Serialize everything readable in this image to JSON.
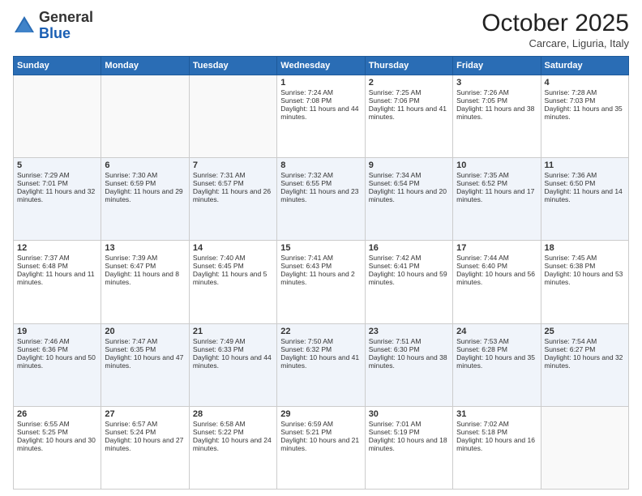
{
  "header": {
    "logo_general": "General",
    "logo_blue": "Blue",
    "month_title": "October 2025",
    "location": "Carcare, Liguria, Italy"
  },
  "days_of_week": [
    "Sunday",
    "Monday",
    "Tuesday",
    "Wednesday",
    "Thursday",
    "Friday",
    "Saturday"
  ],
  "weeks": [
    [
      {
        "day": "",
        "info": ""
      },
      {
        "day": "",
        "info": ""
      },
      {
        "day": "",
        "info": ""
      },
      {
        "day": "1",
        "info": "Sunrise: 7:24 AM\nSunset: 7:08 PM\nDaylight: 11 hours and 44 minutes."
      },
      {
        "day": "2",
        "info": "Sunrise: 7:25 AM\nSunset: 7:06 PM\nDaylight: 11 hours and 41 minutes."
      },
      {
        "day": "3",
        "info": "Sunrise: 7:26 AM\nSunset: 7:05 PM\nDaylight: 11 hours and 38 minutes."
      },
      {
        "day": "4",
        "info": "Sunrise: 7:28 AM\nSunset: 7:03 PM\nDaylight: 11 hours and 35 minutes."
      }
    ],
    [
      {
        "day": "5",
        "info": "Sunrise: 7:29 AM\nSunset: 7:01 PM\nDaylight: 11 hours and 32 minutes."
      },
      {
        "day": "6",
        "info": "Sunrise: 7:30 AM\nSunset: 6:59 PM\nDaylight: 11 hours and 29 minutes."
      },
      {
        "day": "7",
        "info": "Sunrise: 7:31 AM\nSunset: 6:57 PM\nDaylight: 11 hours and 26 minutes."
      },
      {
        "day": "8",
        "info": "Sunrise: 7:32 AM\nSunset: 6:55 PM\nDaylight: 11 hours and 23 minutes."
      },
      {
        "day": "9",
        "info": "Sunrise: 7:34 AM\nSunset: 6:54 PM\nDaylight: 11 hours and 20 minutes."
      },
      {
        "day": "10",
        "info": "Sunrise: 7:35 AM\nSunset: 6:52 PM\nDaylight: 11 hours and 17 minutes."
      },
      {
        "day": "11",
        "info": "Sunrise: 7:36 AM\nSunset: 6:50 PM\nDaylight: 11 hours and 14 minutes."
      }
    ],
    [
      {
        "day": "12",
        "info": "Sunrise: 7:37 AM\nSunset: 6:48 PM\nDaylight: 11 hours and 11 minutes."
      },
      {
        "day": "13",
        "info": "Sunrise: 7:39 AM\nSunset: 6:47 PM\nDaylight: 11 hours and 8 minutes."
      },
      {
        "day": "14",
        "info": "Sunrise: 7:40 AM\nSunset: 6:45 PM\nDaylight: 11 hours and 5 minutes."
      },
      {
        "day": "15",
        "info": "Sunrise: 7:41 AM\nSunset: 6:43 PM\nDaylight: 11 hours and 2 minutes."
      },
      {
        "day": "16",
        "info": "Sunrise: 7:42 AM\nSunset: 6:41 PM\nDaylight: 10 hours and 59 minutes."
      },
      {
        "day": "17",
        "info": "Sunrise: 7:44 AM\nSunset: 6:40 PM\nDaylight: 10 hours and 56 minutes."
      },
      {
        "day": "18",
        "info": "Sunrise: 7:45 AM\nSunset: 6:38 PM\nDaylight: 10 hours and 53 minutes."
      }
    ],
    [
      {
        "day": "19",
        "info": "Sunrise: 7:46 AM\nSunset: 6:36 PM\nDaylight: 10 hours and 50 minutes."
      },
      {
        "day": "20",
        "info": "Sunrise: 7:47 AM\nSunset: 6:35 PM\nDaylight: 10 hours and 47 minutes."
      },
      {
        "day": "21",
        "info": "Sunrise: 7:49 AM\nSunset: 6:33 PM\nDaylight: 10 hours and 44 minutes."
      },
      {
        "day": "22",
        "info": "Sunrise: 7:50 AM\nSunset: 6:32 PM\nDaylight: 10 hours and 41 minutes."
      },
      {
        "day": "23",
        "info": "Sunrise: 7:51 AM\nSunset: 6:30 PM\nDaylight: 10 hours and 38 minutes."
      },
      {
        "day": "24",
        "info": "Sunrise: 7:53 AM\nSunset: 6:28 PM\nDaylight: 10 hours and 35 minutes."
      },
      {
        "day": "25",
        "info": "Sunrise: 7:54 AM\nSunset: 6:27 PM\nDaylight: 10 hours and 32 minutes."
      }
    ],
    [
      {
        "day": "26",
        "info": "Sunrise: 6:55 AM\nSunset: 5:25 PM\nDaylight: 10 hours and 30 minutes."
      },
      {
        "day": "27",
        "info": "Sunrise: 6:57 AM\nSunset: 5:24 PM\nDaylight: 10 hours and 27 minutes."
      },
      {
        "day": "28",
        "info": "Sunrise: 6:58 AM\nSunset: 5:22 PM\nDaylight: 10 hours and 24 minutes."
      },
      {
        "day": "29",
        "info": "Sunrise: 6:59 AM\nSunset: 5:21 PM\nDaylight: 10 hours and 21 minutes."
      },
      {
        "day": "30",
        "info": "Sunrise: 7:01 AM\nSunset: 5:19 PM\nDaylight: 10 hours and 18 minutes."
      },
      {
        "day": "31",
        "info": "Sunrise: 7:02 AM\nSunset: 5:18 PM\nDaylight: 10 hours and 16 minutes."
      },
      {
        "day": "",
        "info": ""
      }
    ]
  ]
}
